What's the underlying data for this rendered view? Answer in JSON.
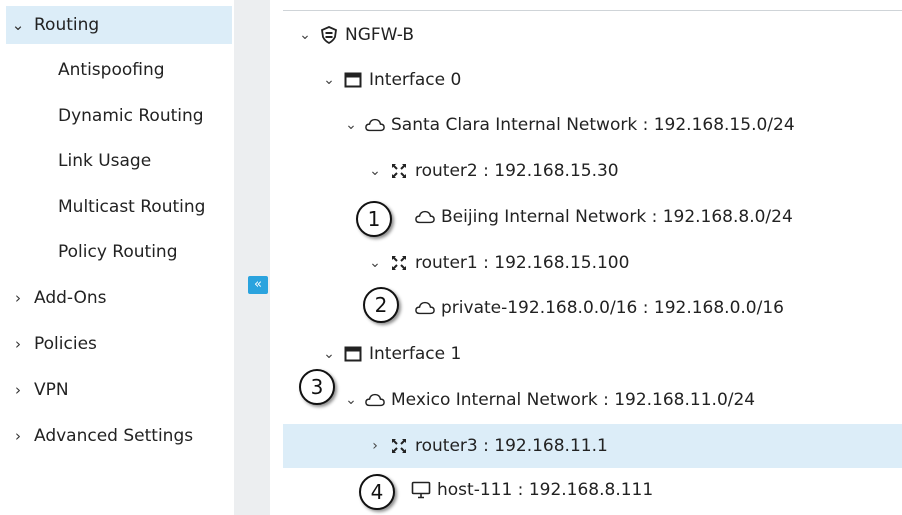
{
  "nav": {
    "routing": "Routing",
    "antispoofing": "Antispoofing",
    "dynamic_routing": "Dynamic Routing",
    "link_usage": "Link Usage",
    "multicast_routing": "Multicast Routing",
    "policy_routing": "Policy Routing",
    "add_ons": "Add-Ons",
    "policies": "Policies",
    "vpn": "VPN",
    "advanced_settings": "Advanced Settings"
  },
  "collapse_button": "«",
  "tree": {
    "ngfw": "NGFW-B",
    "interface0": "Interface 0",
    "santa_clara": "Santa Clara Internal Network : 192.168.15.0/24",
    "router2": "router2 : 192.168.15.30",
    "beijing": "Beijing Internal Network : 192.168.8.0/24",
    "router1": "router1 : 192.168.15.100",
    "private": "private-192.168.0.0/16 : 192.168.0.0/16",
    "interface1": "Interface 1",
    "mexico": "Mexico Internal Network : 192.168.11.0/24",
    "router3": "router3 : 192.168.11.1",
    "host111": "host-111 : 192.168.8.111"
  },
  "callouts": [
    "1",
    "2",
    "3",
    "4"
  ],
  "colors": {
    "selection": "#dcedf8",
    "accent": "#2aa3de",
    "gutter": "#eceef0"
  },
  "icons": {
    "expanded": "chevron-down-icon",
    "collapsed": "chevron-right-icon",
    "engine": "shield-icon",
    "interface": "interface-icon",
    "network": "cloud-icon",
    "router": "router-icon",
    "host": "monitor-icon"
  }
}
